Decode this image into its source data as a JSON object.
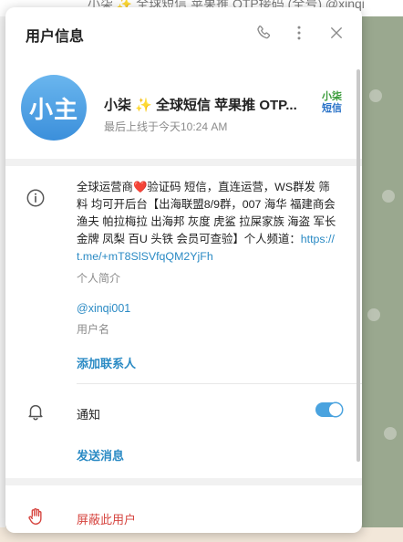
{
  "background": {
    "chat_title": "小柒 ✨ 全球短信 苹果推 OTP接码 (全号) @xinqi"
  },
  "dialog": {
    "title": "用户信息"
  },
  "profile": {
    "avatar_text": "小主",
    "name": "小柒 ✨ 全球短信 苹果推 OTP...",
    "status": "最后上线于今天10:24 AM",
    "tag_line1": "小柒",
    "tag_line2": "短信"
  },
  "info": {
    "bio_part1": "全球运营商",
    "bio_heart": "❤️",
    "bio_part2": "验证码 短信，直连运营，WS群发 筛料 均可开后台【出海联盟8/9群，007 海华 福建商会 渔夫 帕拉梅拉 出海邦 灰度 虎鲨 拉屎家族 海盗 军长 金牌 凤梨 百U 头铁 会员可查验】个人频道：",
    "bio_link": "https://t.me/+mT8SlSVfqQM2YjFh",
    "bio_label": "个人简介",
    "username": "@xinqi001",
    "username_label": "用户名",
    "add_contact": "添加联系人"
  },
  "notifications": {
    "label": "通知",
    "enabled": true,
    "send_message": "发送消息"
  },
  "block": {
    "label": "屏蔽此用户"
  },
  "colors": {
    "accent": "#2a8ac4",
    "toggle": "#4aa3df",
    "danger": "#d6443f",
    "avatar": "#3b8fdb"
  }
}
